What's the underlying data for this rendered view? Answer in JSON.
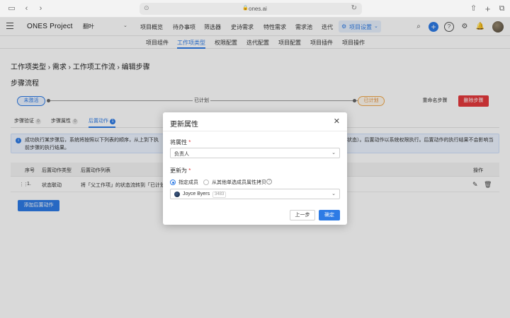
{
  "browser": {
    "url": "ones.ai",
    "icons": [
      "sidebar-toggle-icon",
      "back-icon",
      "forward-icon",
      "shield-icon",
      "lock-icon",
      "reload-icon",
      "share-icon",
      "new-tab-icon",
      "tabs-overview-icon"
    ]
  },
  "topbar": {
    "brand": "ONES Project",
    "project": "翻叶",
    "nav": [
      "项目概览",
      "待办事项",
      "筛选器",
      "史诗需求",
      "特性需求",
      "需求池",
      "迭代"
    ],
    "active_nav": "项目设置"
  },
  "subnav": {
    "items": [
      "项目组件",
      "工作项类型",
      "权限配置",
      "迭代配置",
      "项目配置",
      "项目插件",
      "项目操作"
    ],
    "active_index": 1
  },
  "page": {
    "breadcrumb": "工作项类型 › 需求 › 工作项工作流 › 编辑步骤",
    "section_title": "步骤流程",
    "flow": {
      "from": "未激活",
      "middle": "已计划",
      "to": "已计划"
    },
    "rename_button": "重命名步骤",
    "delete_button": "删除步骤",
    "tabs": [
      {
        "label": "步骤验证",
        "count": "0"
      },
      {
        "label": "步骤属性",
        "count": "0"
      },
      {
        "label": "后置动作",
        "count": "1"
      }
    ],
    "info_line1_a": "成功执行某步骤后，系统将按照以下列表的顺序，从上到下执",
    "info_line1_b": "状态）。后置动作以系统权限执行。后置动作的执行结果不会影响当",
    "info_line2": "前步骤的执行结果。",
    "table": {
      "headers": [
        "序号",
        "后置动作类型",
        "后置动作列表",
        "操作"
      ],
      "rows": [
        {
          "index": "1.",
          "type": "状态联动",
          "action": "将「父工作项」的状态流转到「已计划」"
        }
      ]
    },
    "add_button": "添加后置动作"
  },
  "modal": {
    "title": "更新属性",
    "field1_label": "将属性",
    "field1_value": "负责人",
    "field2_label": "更新为",
    "radio1": "指定成员",
    "radio2": "从其他单选成员属性拷贝",
    "user_name": "Joyce Byers",
    "user_id": "3483",
    "prev_button": "上一步",
    "ok_button": "确定"
  },
  "colors": {
    "accent": "#2d7be5",
    "danger": "#e4393c",
    "warning": "#f0a94e"
  }
}
